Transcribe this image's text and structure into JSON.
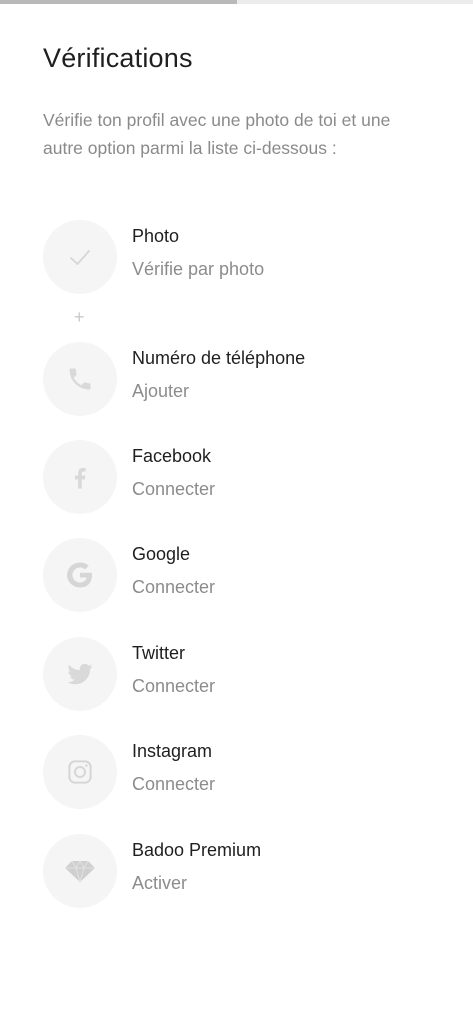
{
  "progress": {
    "fraction": 0.5
  },
  "header": {
    "title": "Vérifications",
    "description": "Vérifie ton profil avec une photo de toi et une autre option parmi la liste ci-dessous :"
  },
  "separator": "+",
  "items": [
    {
      "name": "Photo",
      "action": "Vérifie par photo",
      "icon": "check-icon"
    },
    {
      "name": "Numéro de téléphone",
      "action": "Ajouter",
      "icon": "phone-icon"
    },
    {
      "name": "Facebook",
      "action": "Connecter",
      "icon": "facebook-icon"
    },
    {
      "name": "Google",
      "action": "Connecter",
      "icon": "google-icon"
    },
    {
      "name": "Twitter",
      "action": "Connecter",
      "icon": "twitter-icon"
    },
    {
      "name": "Instagram",
      "action": "Connecter",
      "icon": "instagram-icon"
    },
    {
      "name": "Badoo Premium",
      "action": "Activer",
      "icon": "diamond-icon"
    }
  ],
  "colors": {
    "icon": "#dcdcdc",
    "circle": "#f5f5f5",
    "muted_text": "#8a8a8a"
  }
}
